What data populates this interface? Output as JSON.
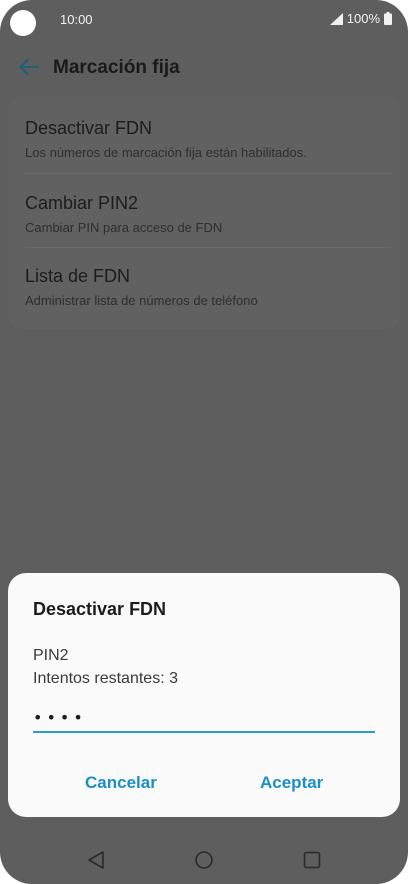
{
  "status_bar": {
    "time": "10:00",
    "battery": "100%"
  },
  "app_bar": {
    "title": "Marcación fija"
  },
  "settings": {
    "items": [
      {
        "title": "Desactivar FDN",
        "subtitle": "Los números de marcación fija están habilitados."
      },
      {
        "title": "Cambiar PIN2",
        "subtitle": "Cambiar PIN para acceso de FDN"
      },
      {
        "title": "Lista de FDN",
        "subtitle": "Administrar lista de números de teléfono"
      }
    ]
  },
  "dialog": {
    "title": "Desactivar FDN",
    "label": "PIN2",
    "attempts": "Intentos restantes: 3",
    "pin_value": "••••",
    "cancel_label": "Cancelar",
    "accept_label": "Aceptar"
  },
  "colors": {
    "accent": "#1a8fc6",
    "underline": "#2a9fc8",
    "scrim": "#5e5e5e"
  }
}
